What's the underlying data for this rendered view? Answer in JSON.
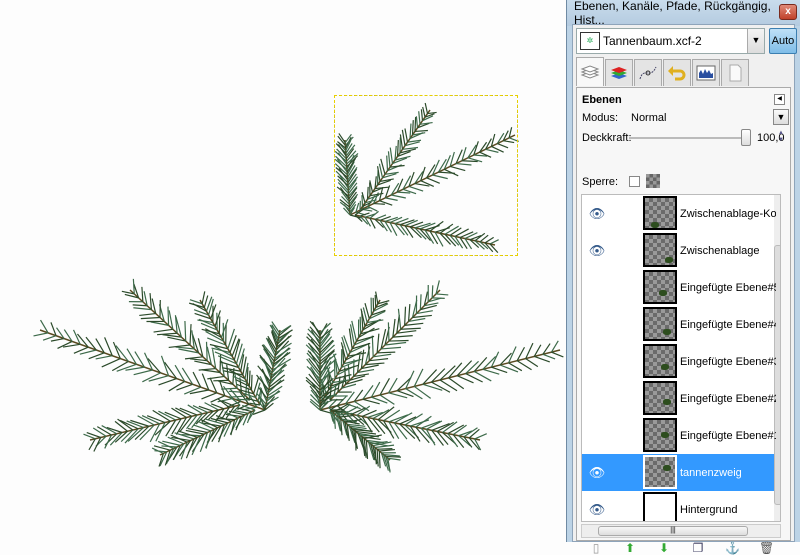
{
  "panel": {
    "title": "Ebenen, Kanäle, Pfade, Rückgängig, Hist...",
    "close_label": "x",
    "image_name": "Tannenbaum.xcf-2",
    "auto_label": "Auto",
    "tabs": [
      "layers-icon",
      "channels-icon",
      "paths-icon",
      "undo-icon",
      "histogram-icon",
      "document-icon"
    ],
    "section_title": "Ebenen",
    "mode_label": "Modus:",
    "mode_value": "Normal",
    "opacity_label": "Deckkraft:",
    "opacity_value": "100,0",
    "opacity_fraction": 1.0,
    "lock_label": "Sperre:",
    "layers": [
      {
        "name": "Zwischenablage-Kopie",
        "visible": true,
        "selected": false
      },
      {
        "name": "Zwischenablage",
        "visible": true,
        "selected": false
      },
      {
        "name": "Eingefügte Ebene#5",
        "visible": false,
        "selected": false
      },
      {
        "name": "Eingefügte Ebene#4",
        "visible": false,
        "selected": false
      },
      {
        "name": "Eingefügte Ebene#3",
        "visible": false,
        "selected": false
      },
      {
        "name": "Eingefügte Ebene#2",
        "visible": false,
        "selected": false
      },
      {
        "name": "Eingefügte Ebene#1",
        "visible": false,
        "selected": false
      },
      {
        "name": "tannenzweig",
        "visible": true,
        "selected": true
      },
      {
        "name": "Hintergrund",
        "visible": true,
        "selected": false
      }
    ],
    "colors": {
      "selection": "#3399ff",
      "needle": "#2b4a2a"
    }
  }
}
